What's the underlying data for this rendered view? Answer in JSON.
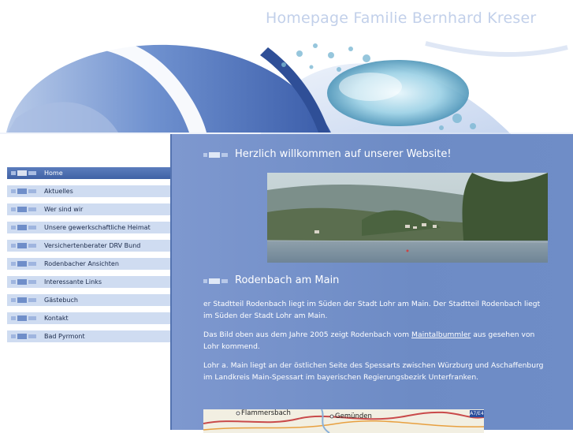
{
  "header": {
    "site_title": "Homepage Familie Bernhard Kreser"
  },
  "nav": {
    "items": [
      {
        "label": "Home",
        "active": true
      },
      {
        "label": "Aktuelles"
      },
      {
        "label": "Wer sind wir"
      },
      {
        "label": "Unsere gewerkschaftliche Heimat"
      },
      {
        "label": "Versichertenberater DRV Bund"
      },
      {
        "label": "Rodenbacher Ansichten"
      },
      {
        "label": "Interessante Links"
      },
      {
        "label": "Gästebuch"
      },
      {
        "label": "Kontakt"
      },
      {
        "label": "Bad Pyrmont"
      }
    ]
  },
  "main": {
    "welcome_heading": "Herzlich willkommen auf unserer Website!",
    "section_heading": "Rodenbach am Main",
    "para1": "er Stadtteil Rodenbach liegt im Süden der Stadt Lohr am Main. Der Stadtteil Rodenbach liegt im Süden der Stadt Lohr am Main.",
    "para2_prefix": "Das Bild oben aus dem Jahre 2005 zeigt Rodenbach vom ",
    "para2_link": "Maintalbummler",
    "para2_suffix": " aus gesehen von Lohr kommend.",
    "para3": "Lohr a. Main liegt an der östlichen Seite des Spessarts zwischen Würzburg und Aschaffenburg im Landkreis Main-Spessart im bayerischen Regierungsbezirk Unterfranken.",
    "map": {
      "label_left": "Flammersbach",
      "label_right": "Gemünden",
      "badge": "A7/E4"
    }
  },
  "colors": {
    "accent": "#3f62a5",
    "nav_bg": "#cfdcf1",
    "content_bg": "#7e98cf",
    "title_color": "#c2d0ea"
  }
}
